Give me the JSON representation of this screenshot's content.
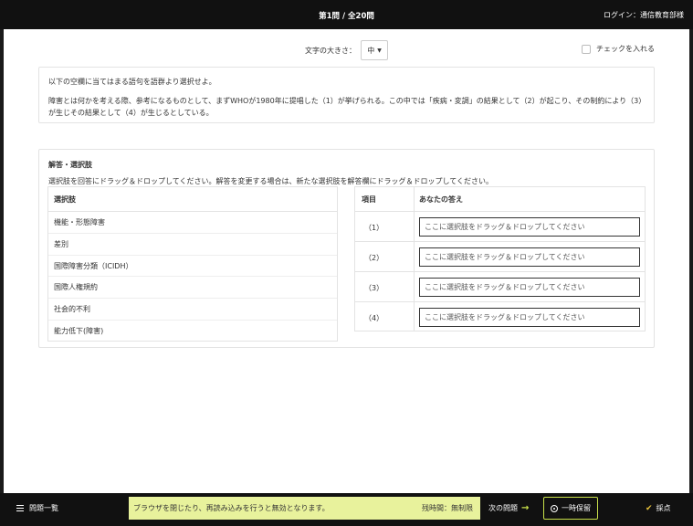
{
  "header": {
    "question_counter": "第1問 / 全20問",
    "login": "ログイン：通信教育部様"
  },
  "toolbar": {
    "font_size_label": "文字の大きさ：",
    "font_size_value": "中",
    "check_label": "チェックを入れる"
  },
  "question": {
    "instruction": "以下の空欄に当てはまる語句を語群より選択せよ。",
    "body": "障害とは何かを考える際、参考になるものとして、まずWHOが1980年に提唱した（1）が挙げられる。この中では「疾病・変調」の結果として（2）が起こり、その制約により（3）が生じその結果として（4）が生じるとしている。"
  },
  "answer_section": {
    "heading": "解答・選択肢",
    "instruction": "選択肢を回答にドラッグ＆ドロップしてください。解答を変更する場合は、新たな選択肢を解答欄にドラッグ＆ドロップしてください。",
    "choices_header": "選択肢",
    "choices": [
      "機能・形態障害",
      "差別",
      "国際障害分類（ICIDH）",
      "国際人権規約",
      "社会的不利",
      "能力低下(障害)"
    ],
    "answers_header_item": "項目",
    "answers_header_answer": "あなたの答え",
    "answers": [
      {
        "num": "（1）",
        "placeholder": "ここに選択肢をドラッグ＆ドロップしてください"
      },
      {
        "num": "（2）",
        "placeholder": "ここに選択肢をドラッグ＆ドロップしてください"
      },
      {
        "num": "（3）",
        "placeholder": "ここに選択肢をドラッグ＆ドロップしてください"
      },
      {
        "num": "（4）",
        "placeholder": "ここに選択肢をドラッグ＆ドロップしてください"
      }
    ]
  },
  "footer": {
    "question_list": "問題一覧",
    "notice": "ブラウザを閉じたり、再読み込みを行うと無効となります。",
    "timer": "残時間：無制限",
    "next": "次の問題",
    "hold": "一時保留",
    "grade": "採点"
  },
  "colors": {
    "accent": "#c8e04a",
    "notice_bg": "#e8f29c",
    "grade_check": "#e8c23a"
  }
}
